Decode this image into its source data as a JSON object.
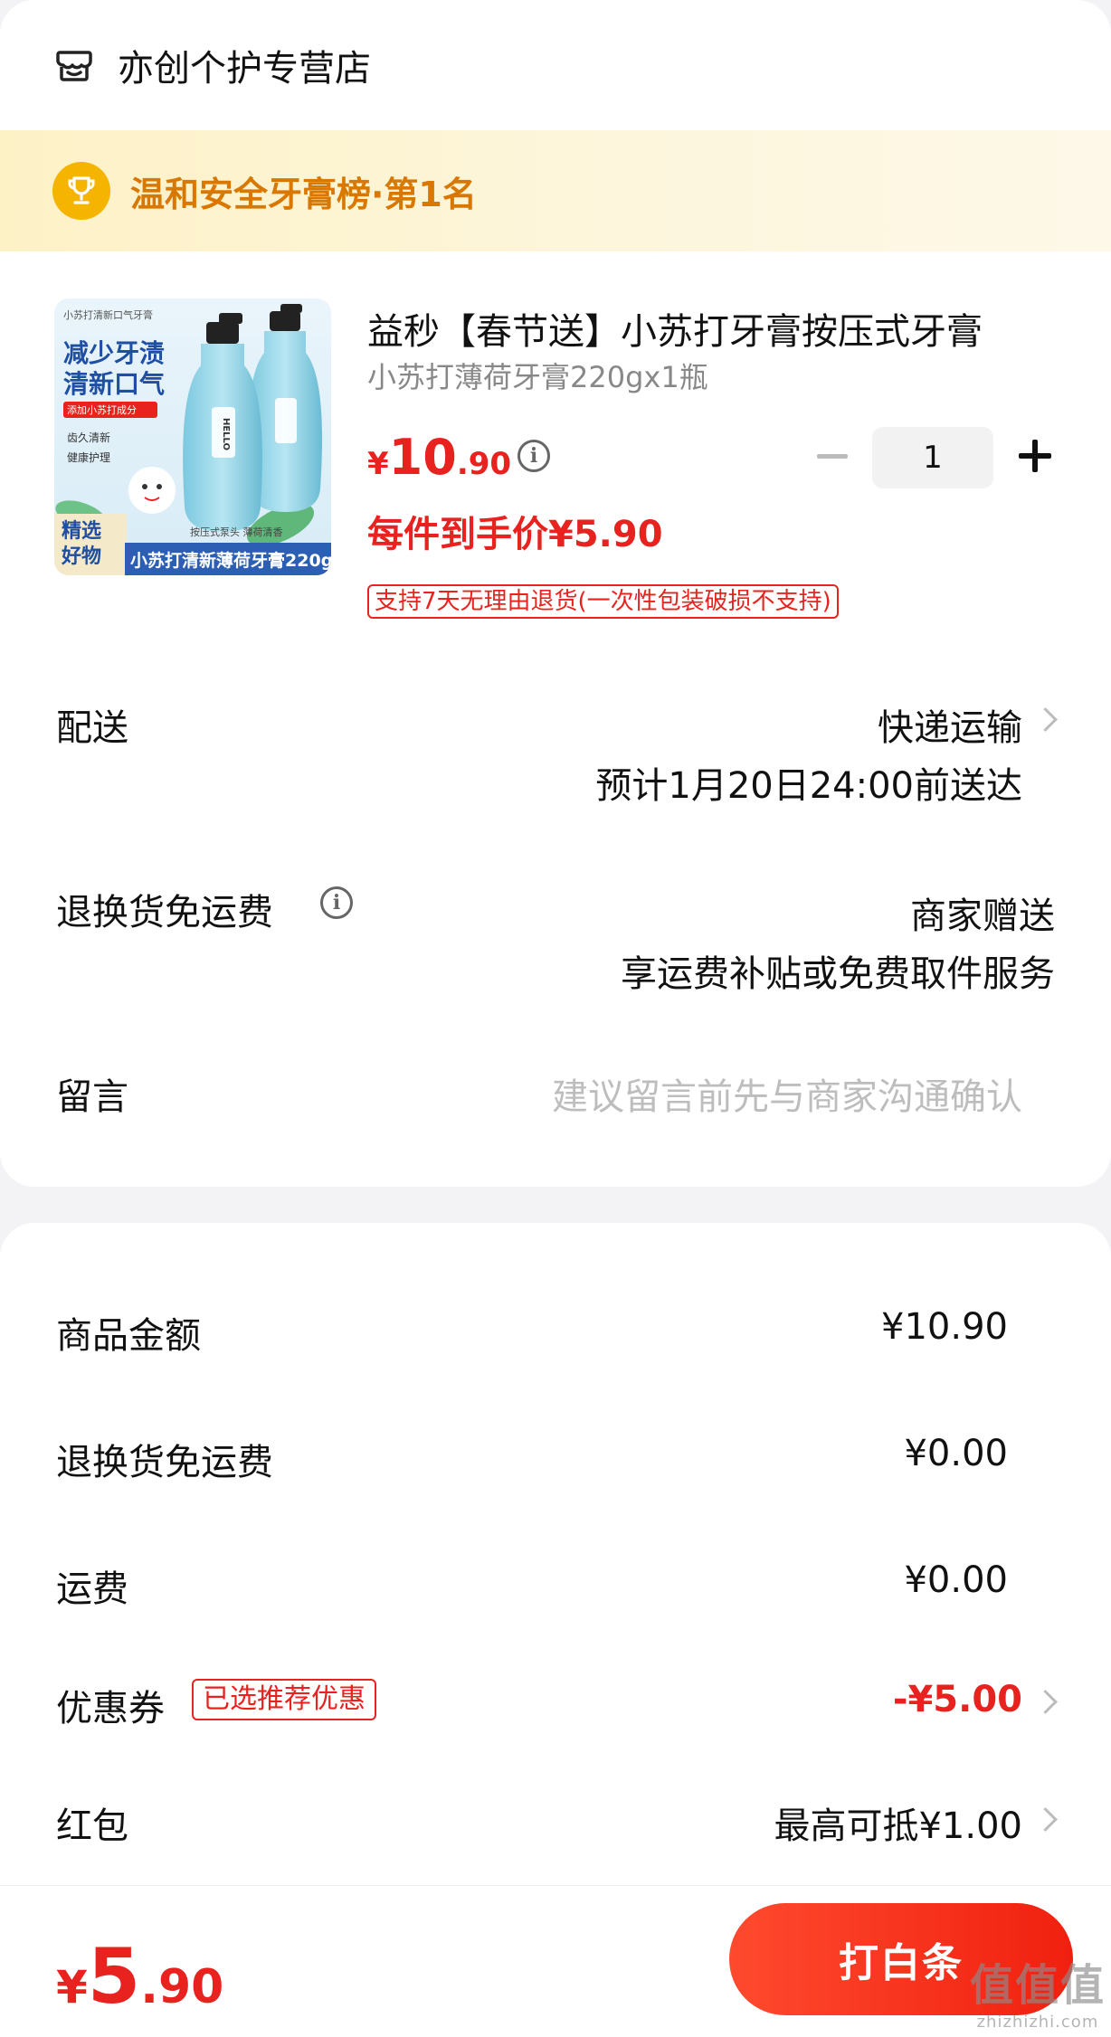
{
  "shop": {
    "name": "亦创个护专营店",
    "icon": "shop-icon"
  },
  "rank": {
    "text": "温和安全牙膏榜·第1名",
    "icon": "trophy-icon"
  },
  "product": {
    "title": "益秒【春节送】小苏打牙膏按压式牙膏",
    "spec": "小苏打薄荷牙膏220gx1瓶",
    "price_symbol": "¥",
    "price_int": "10",
    "price_dec": ".90",
    "unit_price": "每件到手价¥5.90",
    "return_policy": "支持7天无理由退货(一次性包装破损不支持)",
    "quantity": "1",
    "image_text": {
      "top": "小苏打清新口气牙膏",
      "headline1": "减少牙渍",
      "headline2": "清新口气",
      "tag": "添加小苏打成分",
      "check1": "齿久清新",
      "check2": "健康护理",
      "corner1": "精选",
      "corner2": "好物",
      "bottom": "小苏打清新薄荷牙膏220g",
      "sub": "按压式泵头 薄荷清香",
      "bottle": "HELLO"
    }
  },
  "delivery": {
    "label": "配送",
    "method": "快递运输",
    "eta": "预计1月20日24:00前送达"
  },
  "return_shipping": {
    "label": "退换货免运费",
    "value": "商家赠送",
    "desc": "享运费补贴或免费取件服务"
  },
  "message": {
    "label": "留言",
    "placeholder": "建议留言前先与商家沟通确认"
  },
  "summary": {
    "goods_label": "商品金额",
    "goods_value": "¥10.90",
    "return_label": "退换货免运费",
    "return_value": "¥0.00",
    "shipping_label": "运费",
    "shipping_value": "¥0.00",
    "coupon_label": "优惠券",
    "coupon_badge": "已选推荐优惠",
    "coupon_value": "-¥5.00",
    "redpacket_label": "红包",
    "redpacket_value": "最高可抵¥1.00"
  },
  "footer": {
    "total_symbol": "¥",
    "total_int": "5",
    "total_dec": ".90",
    "pay_label": "打白条"
  },
  "watermark": {
    "big": "值值值",
    "small": "zhizhizhi.com"
  },
  "colors": {
    "accent": "#e8231f",
    "gold": "#d97800",
    "banner": "#fdf1c6"
  }
}
